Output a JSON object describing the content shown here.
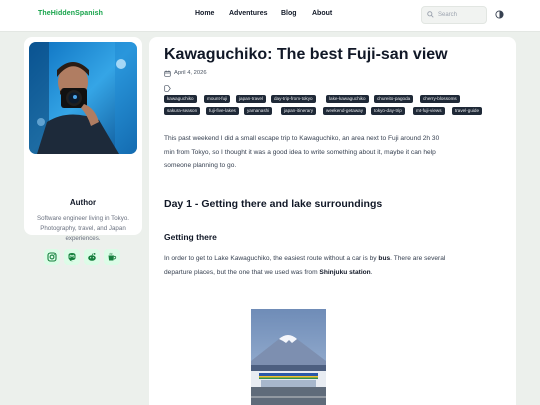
{
  "header": {
    "brand": "TheHiddenSpanish",
    "nav": [
      "Home",
      "Adventures",
      "Blog",
      "About"
    ],
    "search_placeholder": "Search"
  },
  "sidebar": {
    "author_label": "Author",
    "bio": "Software engineer living in Tokyo. Photography, travel, and Japan experiences.",
    "socials": [
      "instagram-icon",
      "mastodon-icon",
      "reddit-icon",
      "coffee-icon"
    ]
  },
  "post": {
    "title": "Kawaguchiko: The best Fuji-san view",
    "date": "April 4, 2026",
    "tags": [
      "kawaguchiko",
      "mount-fuji",
      "japan-travel",
      "day-trip-from-tokyo",
      "lake-kawaguchiko",
      "chureito-pagoda",
      "cherry-blossoms",
      "sakura-season",
      "fuji-five-lakes",
      "yamanashi",
      "japan-itinerary",
      "weekend-getaway",
      "tokyo-day-trip",
      "mt-fuji-views",
      "travel-guide"
    ],
    "intro": "This past weekend I did a small escape trip to Kawaguchiko, an area next to Fuji around 2h 30 min from Tokyo, so I thought it was a good idea to write something about it, maybe it can help someone planning to go.",
    "section_title": "Day 1 - Getting there and lake surroundings",
    "subsection_title": "Getting there",
    "para_a": "In order to get to Lake Kawaguchiko, the easiest route without a car is by ",
    "para_b": "bus",
    "para_c": ". There are several departure places, but the one that we used was from ",
    "para_d": "Shinjuku station",
    "para_e": "."
  },
  "colors": {
    "accent": "#16a34a",
    "tag_bg": "#1f2937",
    "page_bg": "#ecf0ec"
  }
}
